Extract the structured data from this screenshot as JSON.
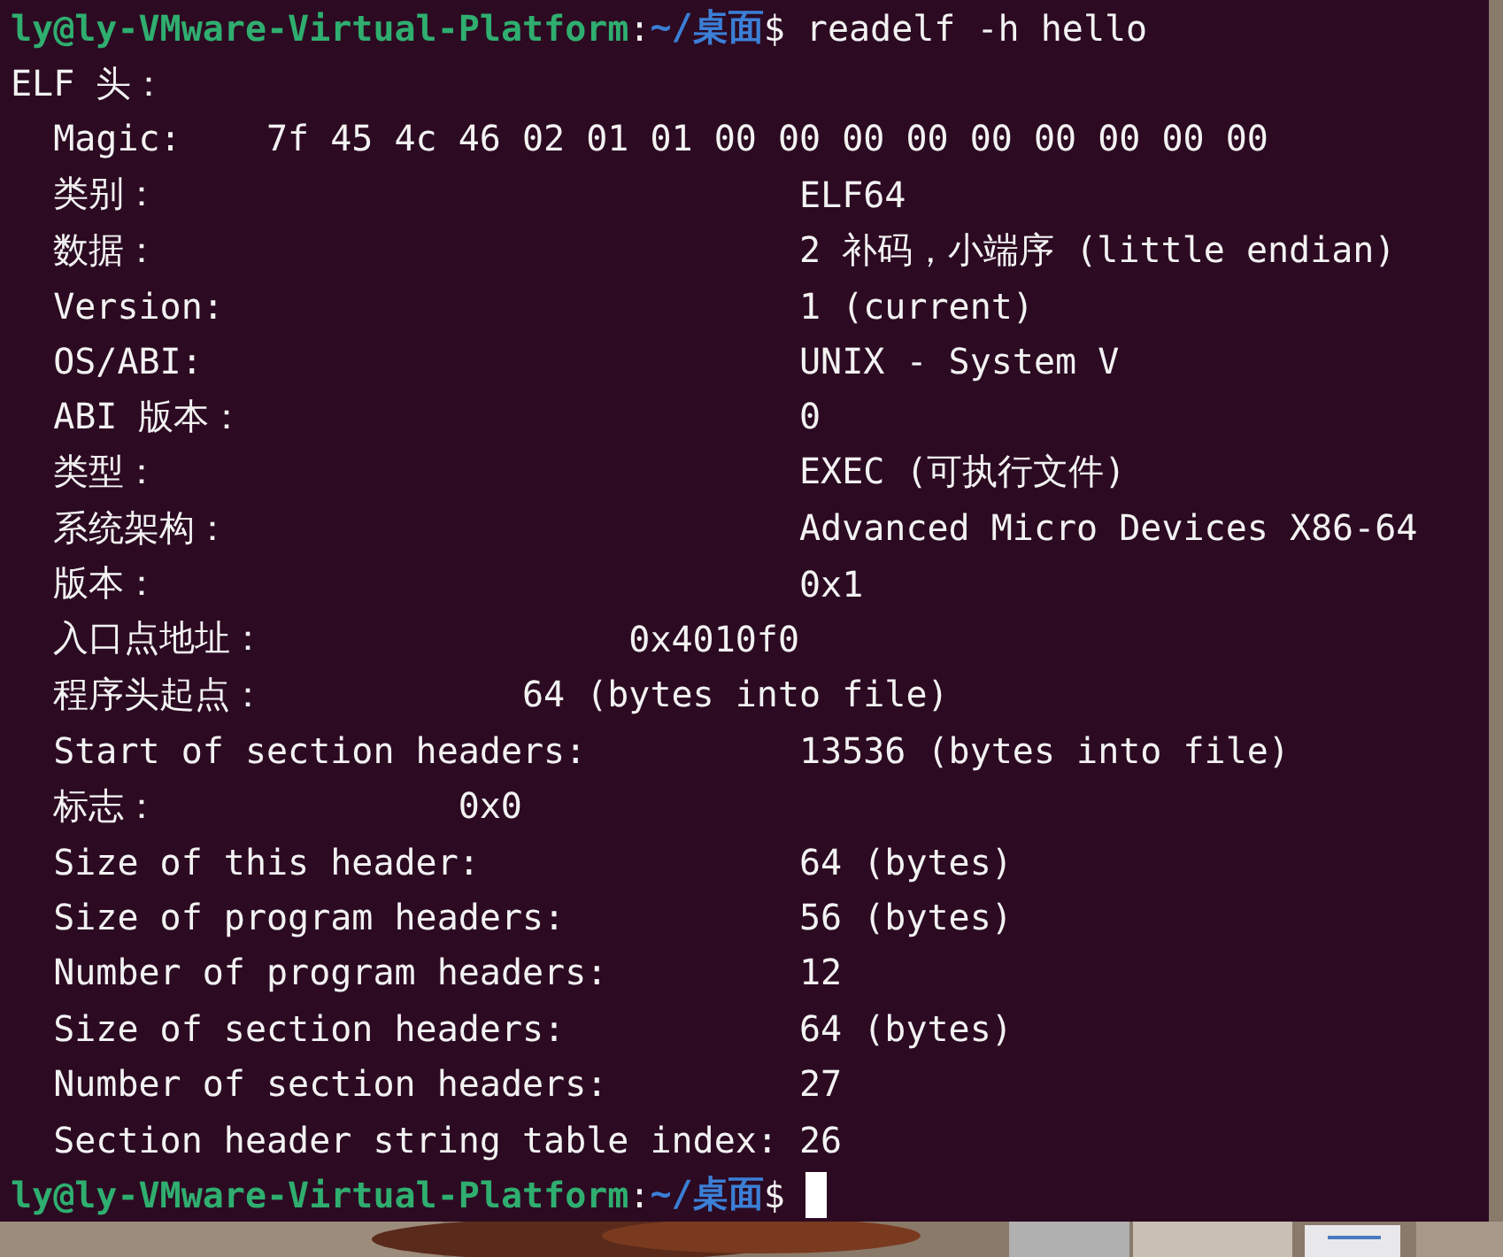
{
  "terminal": {
    "lines": [
      {
        "kind": "prompt",
        "user_host": "ly@ly-VMware-Virtual-Platform",
        "separator": ":",
        "path": "~/桌面",
        "symbol": "$",
        "command": "readelf -h hello"
      },
      {
        "kind": "heading",
        "text": "ELF 头："
      },
      {
        "kind": "field",
        "label": "Magic:",
        "value": "7f 45 4c 46 02 01 01 00 00 00 00 00 00 00 00 00"
      },
      {
        "kind": "field",
        "label": "类别：",
        "value": "ELF64"
      },
      {
        "kind": "field",
        "label": "数据：",
        "value": "2 补码，小端序 (little endian)"
      },
      {
        "kind": "field",
        "label": "Version:",
        "value": "1 (current)"
      },
      {
        "kind": "field",
        "label": "OS/ABI:",
        "value": "UNIX - System V"
      },
      {
        "kind": "field",
        "label": "ABI 版本：",
        "value": "0"
      },
      {
        "kind": "field",
        "label": "类型：",
        "value": "EXEC (可执行文件)"
      },
      {
        "kind": "field",
        "label": "系统架构：",
        "value": "Advanced Micro Devices X86-64"
      },
      {
        "kind": "field",
        "label": "版本：",
        "value": "0x1"
      },
      {
        "kind": "field",
        "label": "入口点地址：",
        "value": "0x4010f0"
      },
      {
        "kind": "field",
        "label": "程序头起点：",
        "value": "64 (bytes into file)"
      },
      {
        "kind": "field",
        "label": "Start of section headers:",
        "value": "13536 (bytes into file)"
      },
      {
        "kind": "field",
        "label": "标志：",
        "value": "0x0"
      },
      {
        "kind": "field",
        "label": "Size of this header:",
        "value": "64 (bytes)"
      },
      {
        "kind": "field",
        "label": "Size of program headers:",
        "value": "56 (bytes)"
      },
      {
        "kind": "field",
        "label": "Number of program headers:",
        "value": "12"
      },
      {
        "kind": "field",
        "label": "Size of section headers:",
        "value": "64 (bytes)"
      },
      {
        "kind": "field",
        "label": "Number of section headers:",
        "value": "27"
      },
      {
        "kind": "field",
        "label": "Section header string table index:",
        "value": "26"
      },
      {
        "kind": "prompt",
        "user_host": "ly@ly-VMware-Virtual-Platform",
        "separator": ":",
        "path": "~/桌面",
        "symbol": "$",
        "cursor": true
      }
    ]
  }
}
